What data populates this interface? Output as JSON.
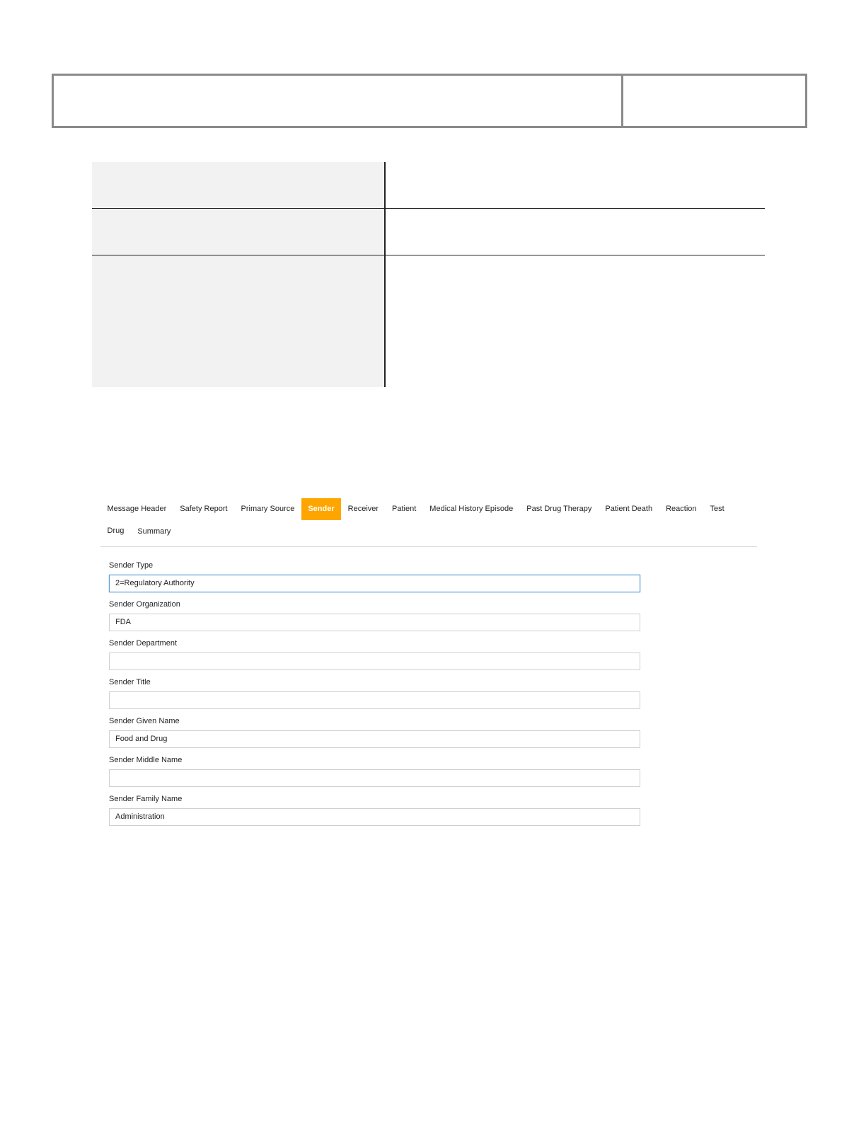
{
  "tabs": [
    {
      "label": "Message Header",
      "active": false
    },
    {
      "label": "Safety Report",
      "active": false
    },
    {
      "label": "Primary Source",
      "active": false
    },
    {
      "label": "Sender",
      "active": true
    },
    {
      "label": "Receiver",
      "active": false
    },
    {
      "label": "Patient",
      "active": false
    },
    {
      "label": "Medical History Episode",
      "active": false
    },
    {
      "label": "Past Drug Therapy",
      "active": false
    },
    {
      "label": "Patient Death",
      "active": false
    },
    {
      "label": "Reaction",
      "active": false
    },
    {
      "label": "Test",
      "active": false
    },
    {
      "label": "Drug",
      "active": false
    },
    {
      "label": "Summary",
      "active": false
    }
  ],
  "colors": {
    "active_tab": "#ffa500",
    "focus_border": "#5b9bd5"
  },
  "form": {
    "sender_type": {
      "label": "Sender Type",
      "value": "2=Regulatory Authority"
    },
    "sender_organization": {
      "label": "Sender Organization",
      "value": "FDA"
    },
    "sender_department": {
      "label": "Sender Department",
      "value": ""
    },
    "sender_title": {
      "label": "Sender Title",
      "value": ""
    },
    "sender_given_name": {
      "label": "Sender Given Name",
      "value": "Food and Drug"
    },
    "sender_middle_name": {
      "label": "Sender Middle Name",
      "value": ""
    },
    "sender_family_name": {
      "label": "Sender Family Name",
      "value": "Administration"
    }
  }
}
